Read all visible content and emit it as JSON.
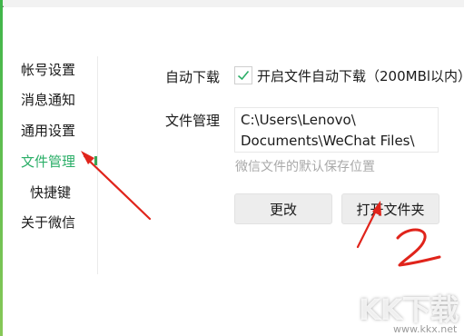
{
  "window": {
    "title_fragment": "。"
  },
  "sidebar": {
    "items": [
      {
        "label": "帐号设置"
      },
      {
        "label": "消息通知"
      },
      {
        "label": "通用设置"
      },
      {
        "label": "文件管理"
      },
      {
        "label": "快捷键"
      },
      {
        "label": "关于微信"
      }
    ],
    "active_index": 3
  },
  "auto_download": {
    "label": "自动下载",
    "checkbox_label": "开启文件自动下载（200MBl以内）",
    "checked": true
  },
  "file_management": {
    "label": "文件管理",
    "path_line1": "C:\\Users\\Lenovo\\",
    "path_line2": "Documents\\WeChat Files\\",
    "hint": "微信文件的默认保存位置"
  },
  "buttons": {
    "change_label": "更改",
    "open_folder_label": "打开文件夹"
  },
  "annotations": {
    "step_number": "2"
  },
  "watermark": {
    "text": "KK下载",
    "url": "www.kkx.net"
  },
  "colors": {
    "accent_green": "#2aae67",
    "annotation_red": "#e0241b",
    "hint_gray": "#a9a9a9",
    "button_bg": "#ededed"
  }
}
